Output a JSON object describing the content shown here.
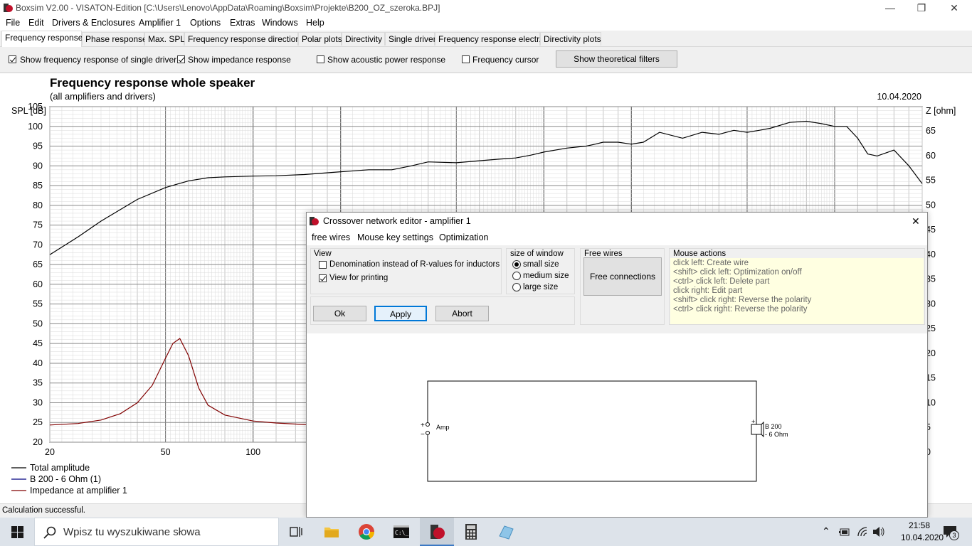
{
  "window": {
    "title": "Boxsim V2.00 - VISATON-Edition [C:\\Users\\Lenovo\\AppData\\Roaming\\Boxsim\\Projekte\\B200_OZ_szeroka.BPJ]",
    "minimize": "—",
    "maximize": "❐",
    "close": "✕"
  },
  "menu": [
    "File",
    "Edit",
    "Drivers & Enclosures",
    "Amplifier 1",
    "Options",
    "Extras",
    "Windows",
    "Help"
  ],
  "tabs": [
    {
      "label": "Frequency response."
    },
    {
      "label": "Phase response"
    },
    {
      "label": "Max. SPL"
    },
    {
      "label": "Frequency response directions"
    },
    {
      "label": "Polar plots"
    },
    {
      "label": "Directivity"
    },
    {
      "label": "Single driver"
    },
    {
      "label": "Frequency response electr.."
    },
    {
      "label": "Directivity plots"
    }
  ],
  "options": {
    "single_driver": {
      "label": "Show frequency response of single driver",
      "checked": true
    },
    "impedance": {
      "label": "Show impedance response",
      "checked": true
    },
    "acoustic_power": {
      "label": "Show acoustic power response",
      "checked": false
    },
    "cursor": {
      "label": "Frequency cursor",
      "checked": false
    },
    "theoretical_button": "Show theoretical filters"
  },
  "chart_data": {
    "type": "line",
    "title": "Frequency response whole speaker",
    "subtitle": "(all amplifiers and drivers)",
    "date": "10.04.2020",
    "ylabel": "SPL [dB]",
    "y2label": "Z [ohm]",
    "x_scale": "log",
    "xlim": [
      20,
      20000
    ],
    "ylim": [
      20,
      105
    ],
    "y2lim": [
      0,
      65
    ],
    "x_ticks": [
      "20",
      "50",
      "100"
    ],
    "y_ticks": [
      "105",
      "100",
      "95",
      "90",
      "85",
      "80",
      "75",
      "70",
      "65",
      "60",
      "55",
      "50",
      "45",
      "40",
      "35",
      "30",
      "25",
      "20"
    ],
    "y2_ticks": [
      "65",
      "60",
      "55",
      "50",
      "45",
      "40",
      "35",
      "30",
      "25",
      "20",
      "15",
      "10",
      "5",
      "0"
    ],
    "grid": true,
    "legend": [
      {
        "name": "Total amplitude",
        "color": "#000000"
      },
      {
        "name": "B 200 - 6 Ohm (1)",
        "color": "#000080"
      },
      {
        "name": "Impedance at amplifier 1",
        "color": "#800000"
      }
    ],
    "series": [
      {
        "name": "Total amplitude",
        "axis": "left",
        "x": [
          20,
          25,
          30,
          40,
          50,
          60,
          70,
          80,
          100,
          120,
          150,
          200,
          250,
          300,
          350,
          400,
          500,
          600,
          700,
          800,
          900,
          1000,
          1200,
          1400,
          1500,
          1600,
          1800,
          2000,
          2200,
          2500,
          3000,
          3500,
          4000,
          4500,
          5000,
          5500,
          6000,
          7000,
          8000,
          9000,
          10000,
          11000,
          12000,
          13000,
          14000,
          16000,
          18000,
          20000
        ],
        "values": [
          67.5,
          72,
          76,
          81.5,
          84.5,
          86.2,
          87,
          87.2,
          87.4,
          87.5,
          87.8,
          88.5,
          89,
          89,
          90,
          91,
          90.8,
          91.3,
          91.7,
          92,
          92.7,
          93.5,
          94.5,
          95,
          95.5,
          96,
          96,
          95.5,
          96,
          98.5,
          97,
          98.5,
          98,
          99,
          98.5,
          99,
          99.5,
          101,
          101.3,
          100.7,
          100,
          100,
          97,
          93,
          92.5,
          94,
          90,
          85.5
        ]
      },
      {
        "name": "Impedance at amplifier 1",
        "axis": "right",
        "x": [
          20,
          25,
          30,
          35,
          40,
          45,
          50,
          53,
          56,
          60,
          65,
          70,
          80,
          100,
          120,
          150,
          200
        ],
        "values": [
          5.5,
          5.8,
          6.5,
          7.8,
          10,
          13.5,
          19,
          22,
          23,
          19.5,
          13,
          9.5,
          7.5,
          6.3,
          5.9,
          5.6,
          5.5
        ]
      }
    ]
  },
  "status": "Calculation successful.",
  "dialog": {
    "title": "Crossover network editor - amplifier 1",
    "close": "✕",
    "menu": [
      "free wires",
      "Mouse key settings",
      "Optimization"
    ],
    "view": {
      "label": "View",
      "denomination": {
        "label": "Denomination instead of R-values for inductors",
        "checked": false
      },
      "printing": {
        "label": "View for printing",
        "checked": true
      }
    },
    "size": {
      "label": "size of window",
      "options": [
        {
          "label": "small size",
          "selected": true
        },
        {
          "label": "medium size",
          "selected": false
        },
        {
          "label": "large size",
          "selected": false
        }
      ]
    },
    "free_wires": {
      "label": "Free wires",
      "button": "Free connections"
    },
    "mouse_actions": {
      "label": "Mouse actions",
      "lines": [
        "click left: Create wire",
        "<shift> click left: Optimization on/off",
        "<ctrl> click left: Delete part",
        "click right: Edit part",
        "<shift> click right: Reverse the polarity",
        "<ctrl> click right: Reverse the polarity"
      ]
    },
    "buttons": {
      "ok": "Ok",
      "apply": "Apply",
      "abort": "Abort"
    },
    "schematic": {
      "amp_label": "Amp",
      "driver_label_1": "B 200",
      "driver_label_2": "- 6 Ohm",
      "plus": "+",
      "minus": "−"
    }
  },
  "taskbar": {
    "search_placeholder": "Wpisz tu wyszukiwane słowa",
    "time": "21:58",
    "date": "10.04.2020",
    "notification_count": "3"
  }
}
